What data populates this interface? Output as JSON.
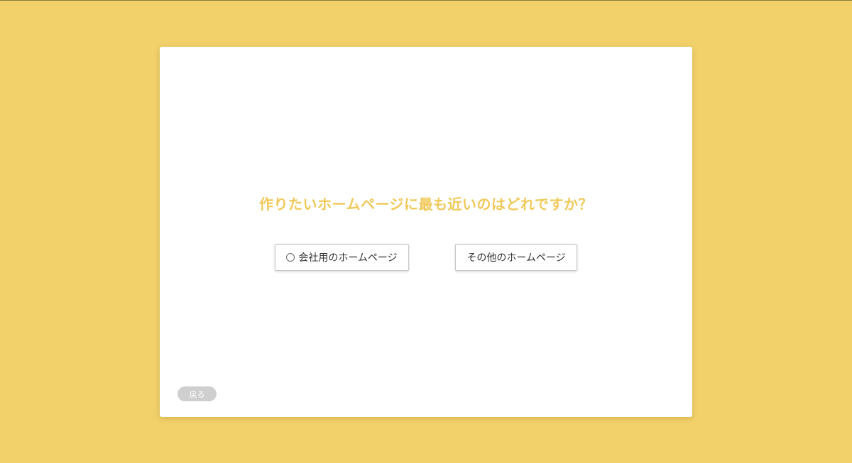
{
  "question": {
    "text": "作りたいホームページに最も近いのはどれですか？"
  },
  "options": [
    {
      "label": "会社用のホームページ",
      "icon": "radio-circle-icon"
    },
    {
      "label": "その他のホームページ"
    }
  ],
  "navigation": {
    "back_label": "戻る"
  },
  "colors": {
    "background": "#f2d16b",
    "accent": "#f0c95a",
    "card": "#ffffff"
  }
}
